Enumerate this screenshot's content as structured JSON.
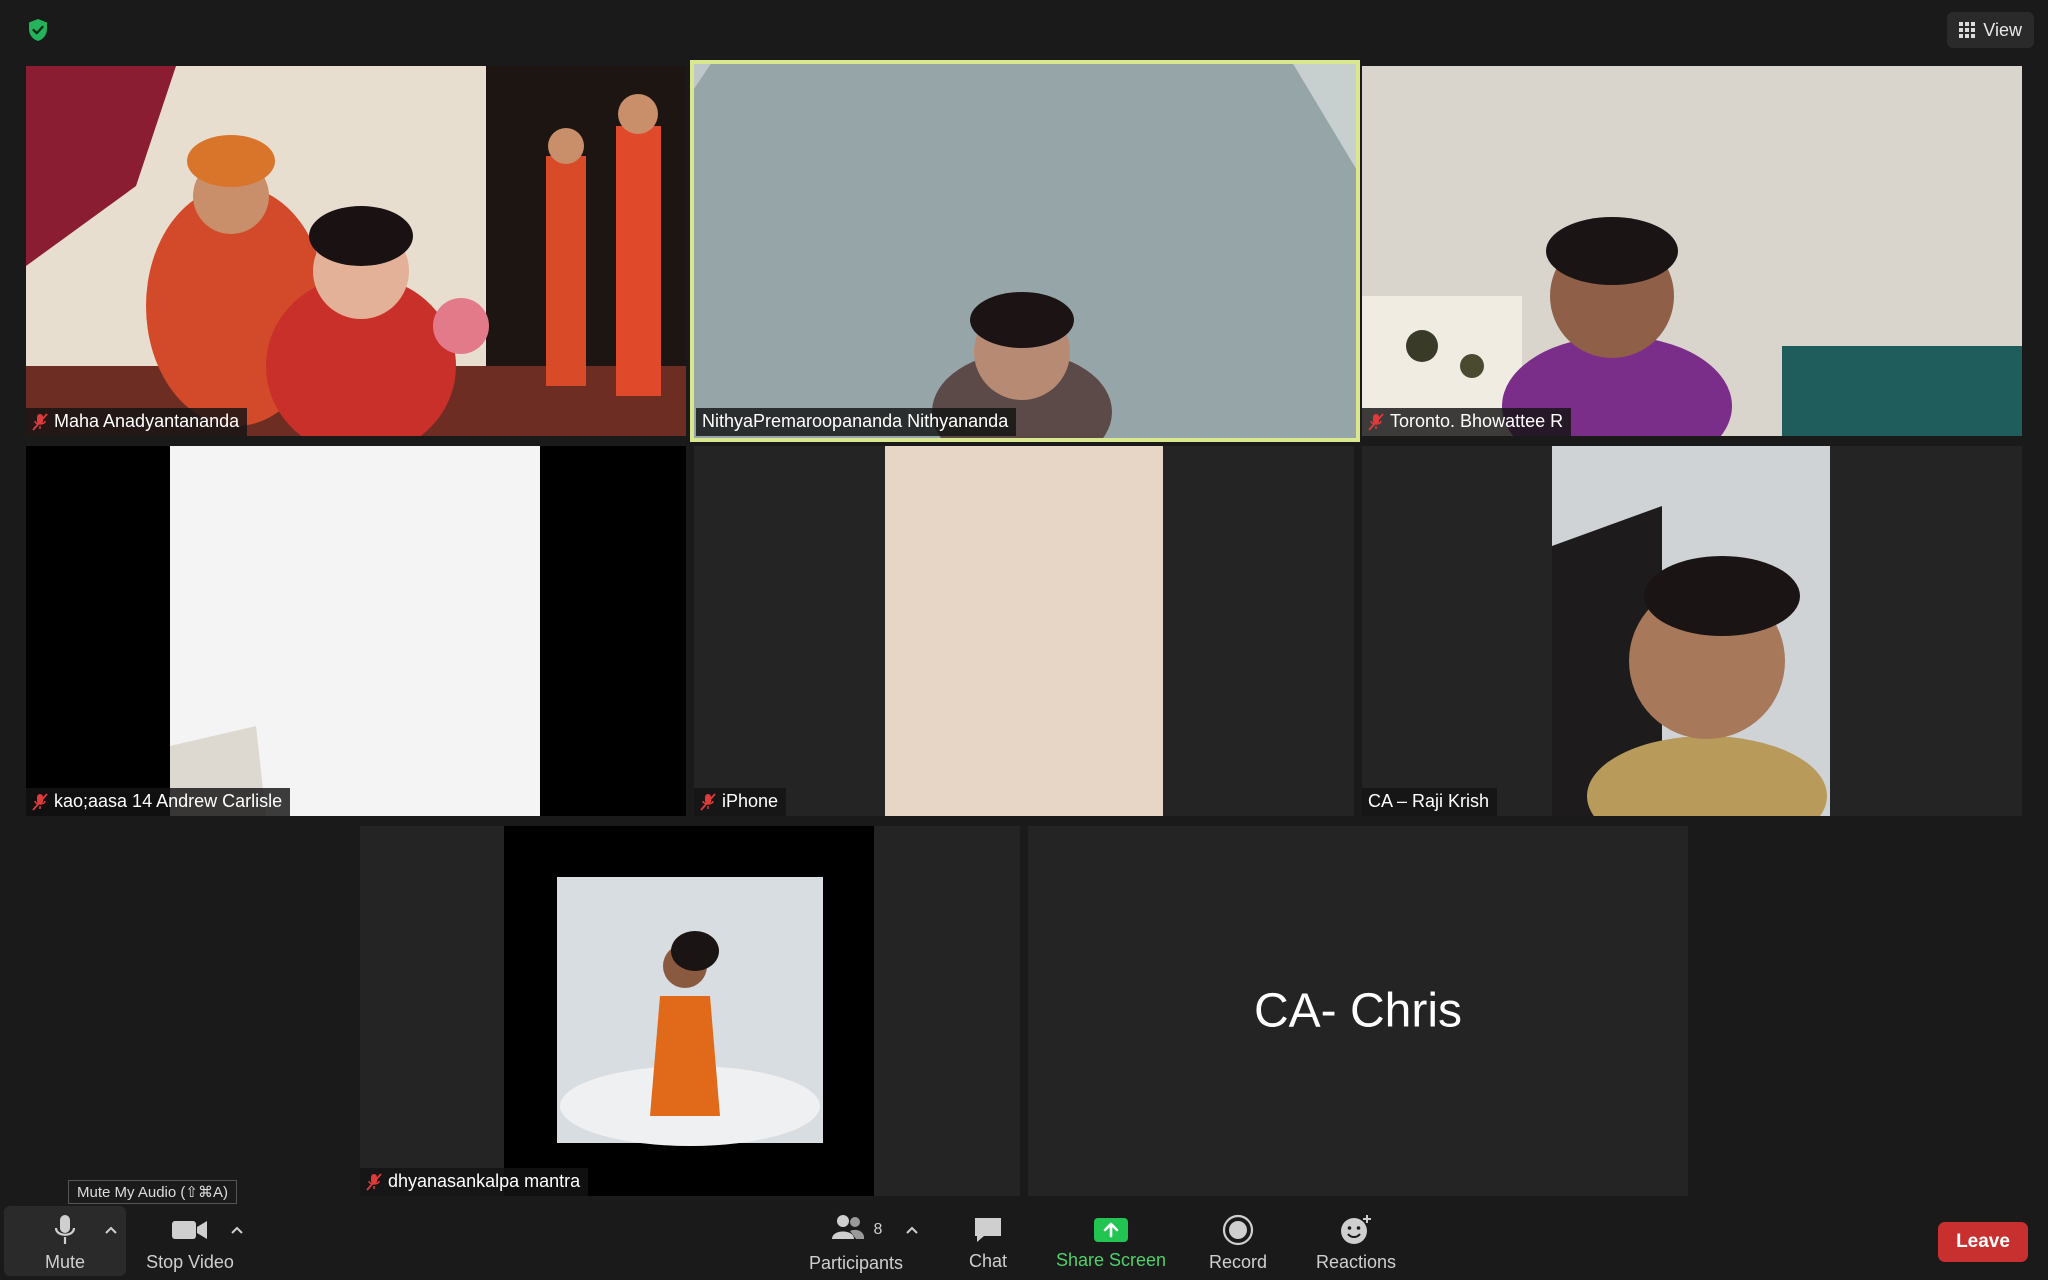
{
  "header": {
    "view_label": "View"
  },
  "participants": [
    {
      "name": "Maha Anadyantananda",
      "muted": true
    },
    {
      "name": "NithyaPremaroopananda Nithyananda",
      "muted": false,
      "active_speaker": true
    },
    {
      "name": "Toronto. Bhowattee R",
      "muted": true
    },
    {
      "name": "kao;aasa 14 Andrew Carlisle",
      "muted": true
    },
    {
      "name": "iPhone",
      "muted": true
    },
    {
      "name": "CA – Raji Krish",
      "muted": false
    },
    {
      "name": "dhyanasankalpa mantra",
      "muted": true
    },
    {
      "name": "CA- Chris",
      "video_off": true
    }
  ],
  "tooltip": "Mute My Audio (⇧⌘A)",
  "toolbar": {
    "mute": "Mute",
    "stop_video": "Stop Video",
    "participants": "Participants",
    "participant_count": "8",
    "chat": "Chat",
    "share_screen": "Share Screen",
    "record": "Record",
    "reactions": "Reactions",
    "leave": "Leave"
  },
  "colors": {
    "active_speaker_border": "#d9e88f",
    "share_green": "#23c552",
    "leave_red": "#c7302e",
    "muted_red": "#e03a3a",
    "security_green": "#24b35a"
  }
}
